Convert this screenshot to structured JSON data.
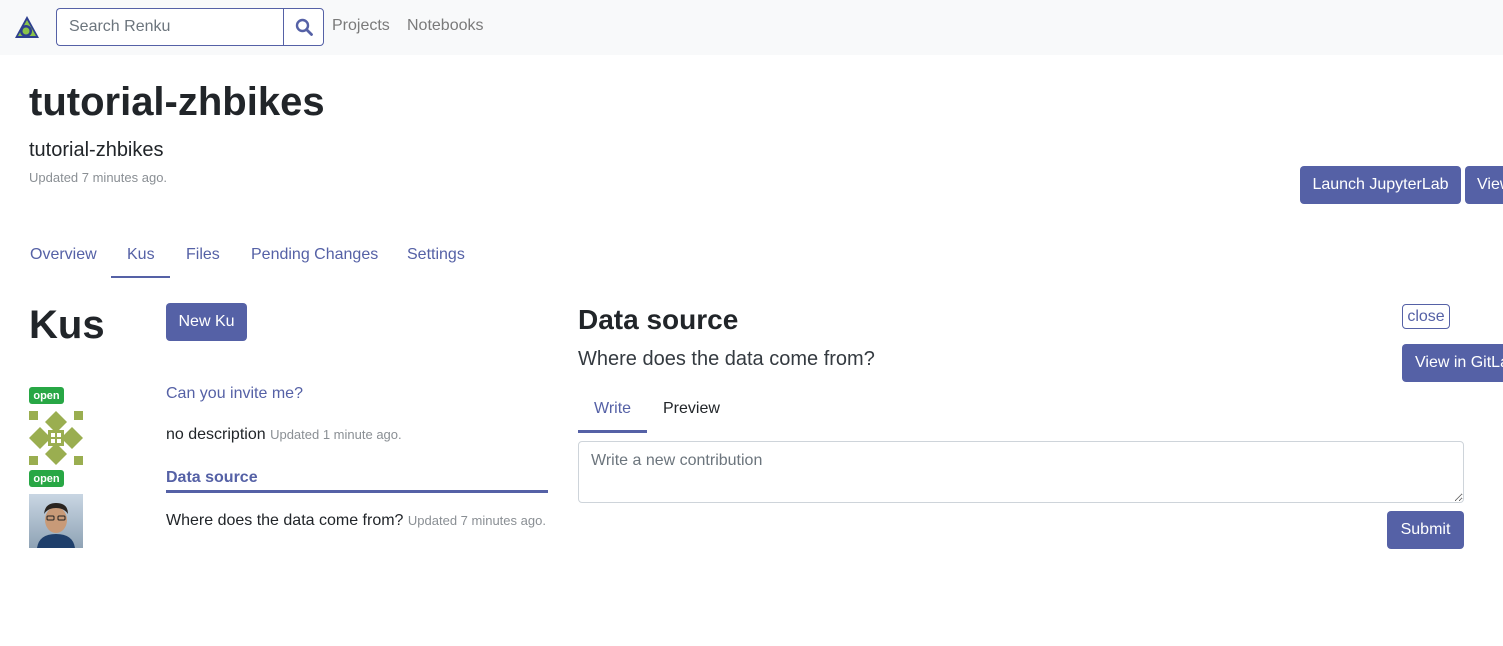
{
  "navbar": {
    "search": {
      "placeholder": "Search Renku",
      "value": ""
    },
    "links": [
      "Projects",
      "Notebooks"
    ]
  },
  "project": {
    "title": "tutorial-zhbikes",
    "subtitle": "tutorial-zhbikes",
    "updated": "Updated 7 minutes ago.",
    "actions": {
      "launch_label": "Launch JupyterLab",
      "view_label": "View"
    }
  },
  "tabs": [
    {
      "label": "Overview",
      "active": false
    },
    {
      "label": "Kus",
      "active": true
    },
    {
      "label": "Files",
      "active": false
    },
    {
      "label": "Pending Changes",
      "active": false
    },
    {
      "label": "Settings",
      "active": false
    }
  ],
  "kus": {
    "title": "Kus",
    "new_label": "New Ku",
    "items": [
      {
        "badge": "open",
        "title": "Can you invite me?",
        "description": "no description",
        "updated": "Updated 1 minute ago."
      },
      {
        "badge": "open",
        "title": "Data source",
        "description": "Where does the data come from?",
        "updated": "Updated 7 minutes ago.",
        "selected": true
      }
    ]
  },
  "detail": {
    "title": "Data source",
    "description": "Where does the data come from?",
    "close_label": "close",
    "gitlab_label": "View in GitLab",
    "tabs": [
      {
        "label": "Write",
        "active": true
      },
      {
        "label": "Preview",
        "active": false
      }
    ],
    "contribution": {
      "placeholder": "Write a new contribution",
      "value": ""
    },
    "submit_label": "Submit"
  },
  "colors": {
    "primary": "#5561a6",
    "badge_open": "#28a745",
    "navbar_bg": "#f8f9fa",
    "identicon": "#9aae50"
  },
  "icons": [
    "renku-logo-icon",
    "search-icon",
    "identicon-avatar",
    "user-photo-avatar"
  ]
}
